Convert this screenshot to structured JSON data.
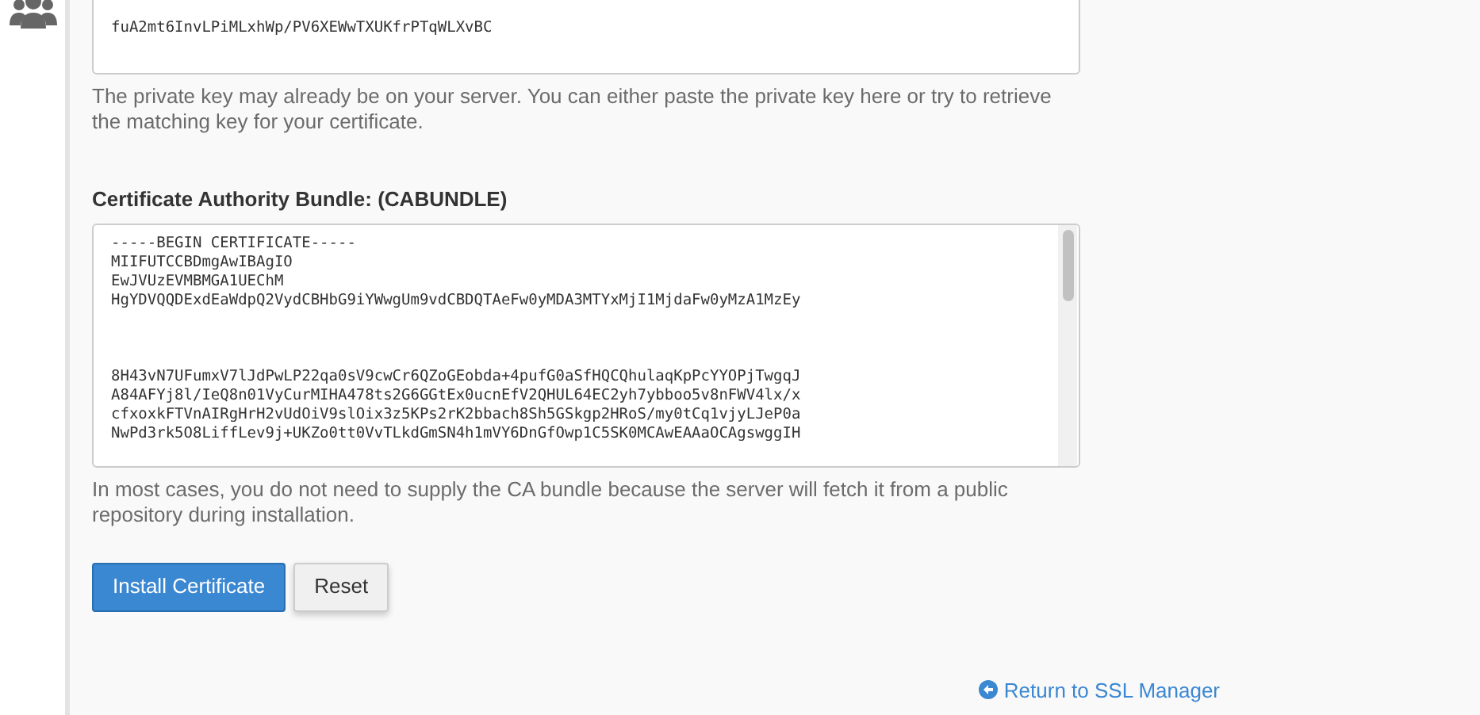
{
  "private_key": {
    "value": "fuA2mt6InvLPiMLxhWp/PV6XEWwTXUKfrPTqWLXvBC",
    "help": "The private key may already be on your server. You can either paste the private key here or try to retrieve the matching key for your certificate."
  },
  "cabundle": {
    "label": "Certificate Authority Bundle: (CABUNDLE)",
    "value": "-----BEGIN CERTIFICATE-----\nMIIFUTCCBDmgAwIBAgIO\nEwJVUzEVMBMGA1UEChM\nHgYDVQQDExdEaWdpQ2VydCBHbG9iYWwgUm9vdCBDQTAeFw0yMDA3MTYxMjI1MjdaFw0yMzA1MzEy\n\n\n\n8H43vN7UFumxV7lJdPwLP22qa0sV9cwCr6QZoGEobda+4pufG0aSfHQCQhulaqKpPcYYOPjTwgqJ\nA84AFYj8l/IeQ8n01VyCurMIHA478ts2G6GGtEx0ucnEfV2QHUL64EC2yh7ybboo5v8nFWV4lx/x\ncfxoxkFTVnAIRgHrH2vUdOiV9slOix3z5KPs2rK2bbach8Sh5GSkgp2HRoS/my0tCq1vjyLJeP0a\nNwPd3rk5O8LiffLev9j+UKZo0tt0VvTLkdGmSN4h1mVY6DnGfOwp1C5SK0MCAwEAAaOCAgswggIH",
    "help": "In most cases, you do not need to supply the CA bundle because the server will fetch it from a public repository during installation."
  },
  "buttons": [
    {
      "label": "Install Certificate",
      "kind": "primary"
    },
    {
      "label": "Reset",
      "kind": "default"
    }
  ],
  "return_link": "Return to SSL Manager"
}
